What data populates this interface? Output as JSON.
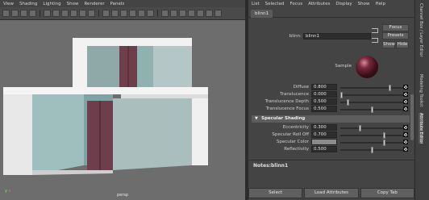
{
  "viewport": {
    "menu": [
      "View",
      "Shading",
      "Lighting",
      "Show",
      "Renderer",
      "Panels"
    ],
    "camera_label": "persp"
  },
  "attribute_editor": {
    "menu": [
      "List",
      "Selected",
      "Focus",
      "Attributes",
      "Display",
      "Show",
      "Help"
    ],
    "tab": "blinn1",
    "name_label": "blinn:",
    "name_value": "blinn1",
    "buttons": {
      "focus": "Focus",
      "presets": "Presets",
      "show": "Show",
      "hide": "Hide"
    },
    "sample_label": "Sample",
    "common_attrs": [
      {
        "label": "Diffuse",
        "value": "0.800",
        "slider": 0.8
      },
      {
        "label": "Translucence",
        "value": "0.000",
        "slider": 0.0
      },
      {
        "label": "Translucence Depth",
        "value": "0.500",
        "slider": 0.1
      },
      {
        "label": "Translucence Focus",
        "value": "0.500",
        "slider": 0.5
      }
    ],
    "specular_section": "Specular Shading",
    "specular_attrs": [
      {
        "label": "Eccentricity",
        "value": "0.300",
        "slider": 0.3
      },
      {
        "label": "Specular Roll Off",
        "value": "0.700",
        "slider": 0.7
      },
      {
        "label": "Specular Color",
        "value": "",
        "slider": 0.7
      },
      {
        "label": "Reflectivity",
        "value": "0.500",
        "slider": 0.5
      }
    ],
    "notes_label": "Notes:",
    "notes_value": "blinn1",
    "bottom_buttons": [
      "Select",
      "Load Attributes",
      "Copy Tab"
    ]
  },
  "side_tabs": [
    "Channel Box / Layer Editor",
    "Modeling Toolkit",
    "Attribute Editor"
  ],
  "colors": {
    "accent_mauve": "#6e3e4c",
    "glass": "#8fb1b0"
  }
}
